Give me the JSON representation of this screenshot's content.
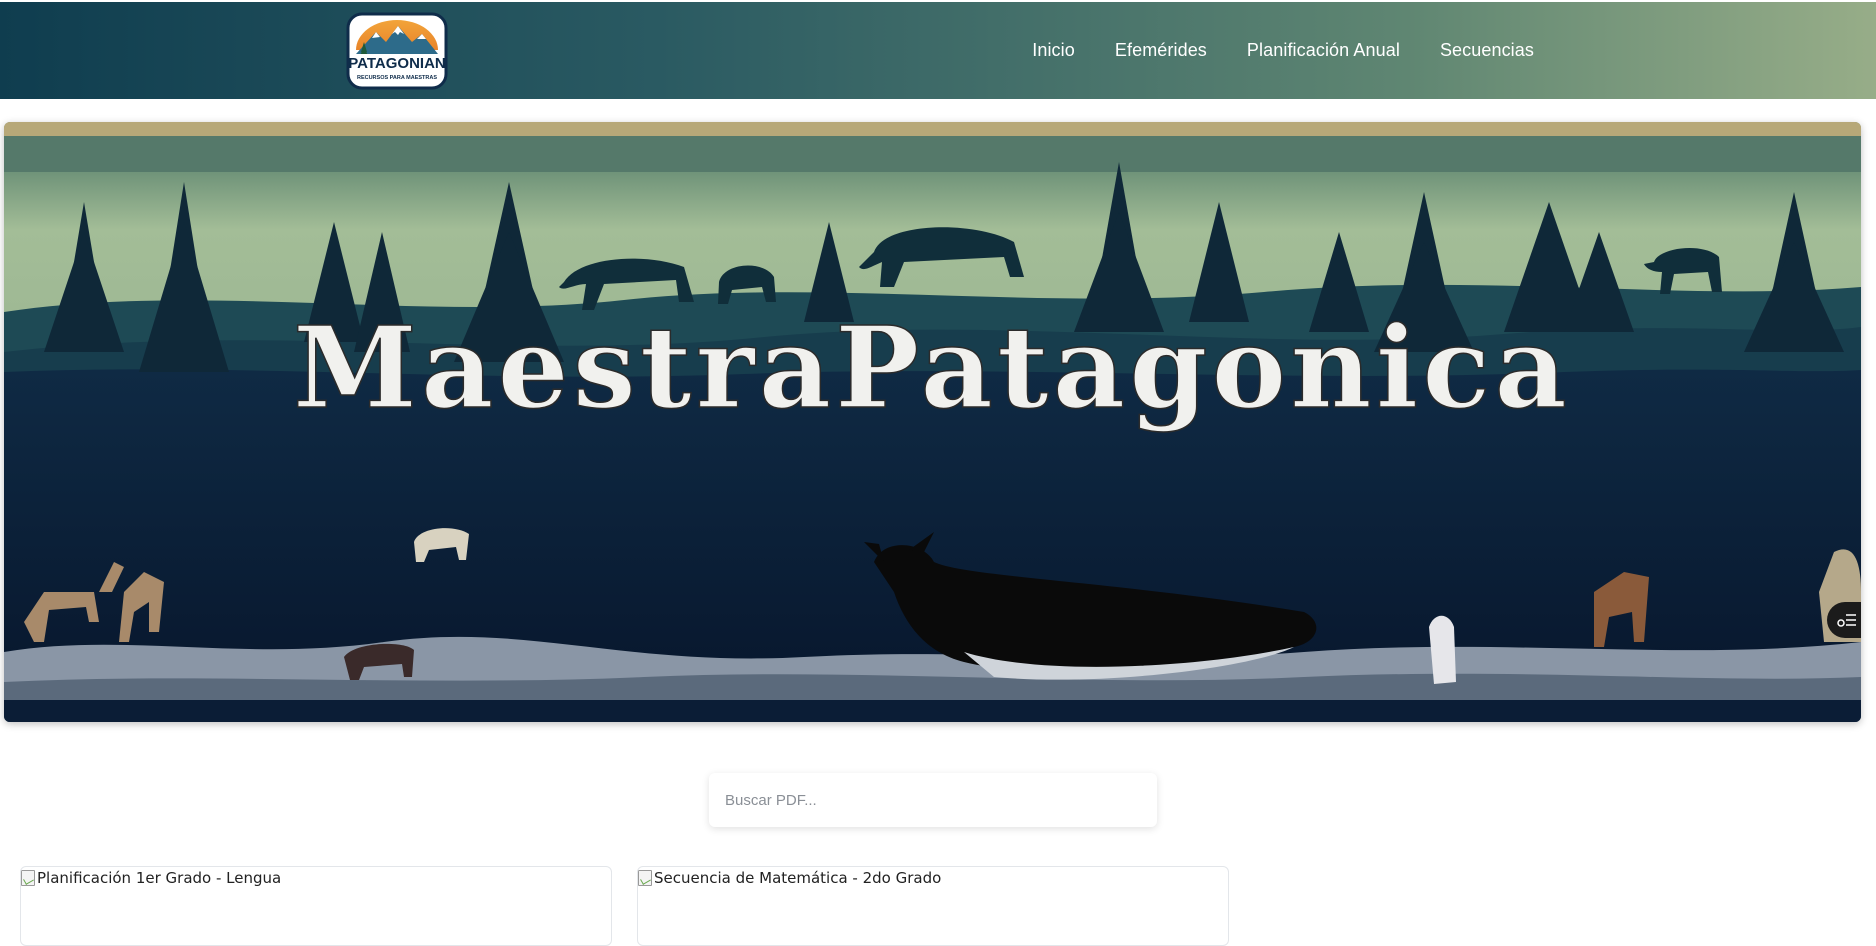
{
  "logo": {
    "text": "PATAGONIAN",
    "subtext": "RECURSOS PARA MAESTRAS"
  },
  "nav": {
    "items": [
      {
        "label": "Inicio"
      },
      {
        "label": "Efemérides"
      },
      {
        "label": "Planificación Anual"
      },
      {
        "label": "Secuencias"
      }
    ]
  },
  "hero": {
    "title": "MaestraPatagonica"
  },
  "search": {
    "placeholder": "Buscar PDF...",
    "value": ""
  },
  "cards": [
    {
      "image_alt": "Planificación 1er Grado - Lengua"
    },
    {
      "image_alt": "Secuencia de Matemática - 2do Grado"
    }
  ],
  "side_tab": {
    "icon": "toc-settings-icon"
  },
  "colors": {
    "header_start": "#0f3d4f",
    "header_end": "#97ad88",
    "hero_sky": "#a7c09a",
    "hero_dark": "#0b1d36",
    "hero_border": "#b7a878"
  }
}
